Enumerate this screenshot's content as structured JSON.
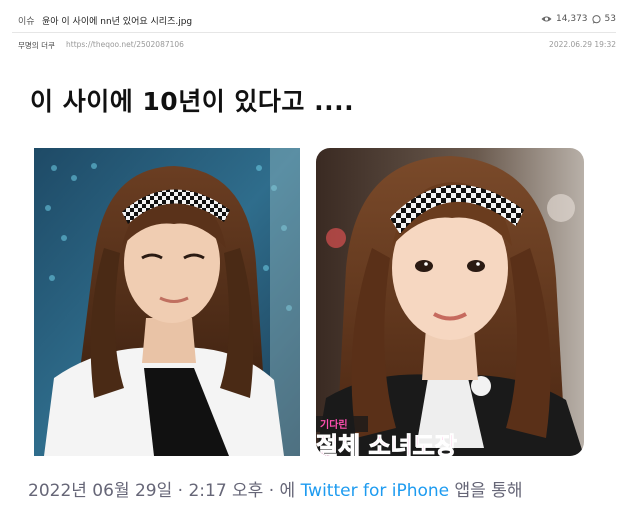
{
  "post": {
    "category": "이슈",
    "title": "윤아 이 사이에 nn년 있어요 시리즈.jpg",
    "views": "14,373",
    "comments": "53",
    "author": "무명의 더쿠",
    "url": "https://theqoo.net/2502087106",
    "date": "2022.06.29 19:32"
  },
  "tweet": {
    "text": "이 사이에 10년이 있다고 ....",
    "timestamp_prefix": "2022년 06월 29일 · 2:17 오후 · 에",
    "via_app": "Twitter for iPhone",
    "via_suffix": "앱을 통해"
  },
  "photos": {
    "left_alt": "older stage photo",
    "right_alt": "recent broadcast photo",
    "right_caption_strip": "기다린",
    "right_caption_big": "절체 소녀도장"
  },
  "colors": {
    "link": "#1d9bf0",
    "footer_text": "#667788",
    "headline": "#111111"
  }
}
